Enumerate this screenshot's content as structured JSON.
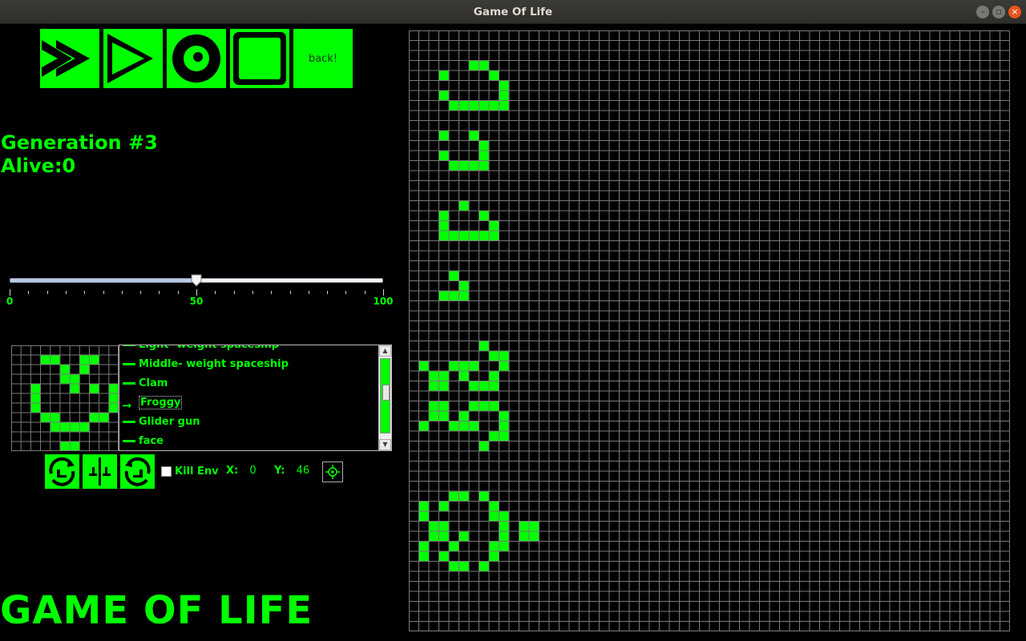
{
  "window": {
    "title": "Game Of Life"
  },
  "toolbar": {
    "buttons": [
      {
        "name": "fast-forward-button",
        "icon": "fast-forward-icon"
      },
      {
        "name": "play-button",
        "icon": "play-icon"
      },
      {
        "name": "reset-button",
        "icon": "reset-icon"
      },
      {
        "name": "stop-button",
        "icon": "stop-icon"
      }
    ],
    "back_label": "back!"
  },
  "stats": {
    "generation": "Generation #3",
    "alive": "Alive:0"
  },
  "speed_slider": {
    "min": 0,
    "max": 100,
    "value": 50,
    "labels": [
      "0",
      "50",
      "100"
    ]
  },
  "patterns": {
    "items": [
      "Light- weight spaceship",
      "Middle- weight spaceship",
      "Clam",
      "Froggy",
      "Glider gun",
      "face"
    ],
    "selected": "Froggy"
  },
  "preview_cells": [
    [
      3,
      1
    ],
    [
      4,
      1
    ],
    [
      7,
      1
    ],
    [
      8,
      1
    ],
    [
      5,
      2
    ],
    [
      7,
      2
    ],
    [
      5,
      3
    ],
    [
      6,
      3
    ],
    [
      2,
      4
    ],
    [
      6,
      4
    ],
    [
      8,
      4
    ],
    [
      10,
      4
    ],
    [
      2,
      5
    ],
    [
      10,
      5
    ],
    [
      2,
      6
    ],
    [
      10,
      6
    ],
    [
      3,
      7
    ],
    [
      4,
      7
    ],
    [
      8,
      7
    ],
    [
      9,
      7
    ],
    [
      4,
      8
    ],
    [
      5,
      8
    ],
    [
      6,
      8
    ],
    [
      7,
      8
    ],
    [
      5,
      10
    ],
    [
      6,
      10
    ],
    [
      5,
      11
    ],
    [
      6,
      11
    ]
  ],
  "controls": {
    "kill_env_label": "Kill Env",
    "kill_env_checked": false,
    "x_label": "X:",
    "x_value": "0",
    "y_label": "Y:",
    "y_value": "46"
  },
  "board_cells": [
    [
      6,
      3
    ],
    [
      7,
      3
    ],
    [
      3,
      4
    ],
    [
      8,
      4
    ],
    [
      9,
      5
    ],
    [
      3,
      6
    ],
    [
      9,
      6
    ],
    [
      4,
      7
    ],
    [
      5,
      7
    ],
    [
      6,
      7
    ],
    [
      7,
      7
    ],
    [
      8,
      7
    ],
    [
      9,
      7
    ],
    [
      3,
      10
    ],
    [
      6,
      10
    ],
    [
      7,
      11
    ],
    [
      3,
      12
    ],
    [
      7,
      12
    ],
    [
      4,
      13
    ],
    [
      5,
      13
    ],
    [
      6,
      13
    ],
    [
      7,
      13
    ],
    [
      5,
      17
    ],
    [
      3,
      18
    ],
    [
      7,
      18
    ],
    [
      3,
      19
    ],
    [
      8,
      19
    ],
    [
      3,
      20
    ],
    [
      4,
      20
    ],
    [
      5,
      20
    ],
    [
      6,
      20
    ],
    [
      7,
      20
    ],
    [
      8,
      20
    ],
    [
      4,
      24
    ],
    [
      5,
      25
    ],
    [
      3,
      26
    ],
    [
      4,
      26
    ],
    [
      5,
      26
    ],
    [
      7,
      31
    ],
    [
      8,
      32
    ],
    [
      9,
      32
    ],
    [
      1,
      33
    ],
    [
      4,
      33
    ],
    [
      5,
      33
    ],
    [
      6,
      33
    ],
    [
      9,
      33
    ],
    [
      2,
      34
    ],
    [
      3,
      34
    ],
    [
      5,
      34
    ],
    [
      8,
      34
    ],
    [
      2,
      35
    ],
    [
      3,
      35
    ],
    [
      6,
      35
    ],
    [
      7,
      35
    ],
    [
      8,
      35
    ],
    [
      2,
      37
    ],
    [
      3,
      37
    ],
    [
      6,
      37
    ],
    [
      7,
      37
    ],
    [
      8,
      37
    ],
    [
      2,
      38
    ],
    [
      3,
      38
    ],
    [
      5,
      38
    ],
    [
      9,
      38
    ],
    [
      1,
      39
    ],
    [
      4,
      39
    ],
    [
      5,
      39
    ],
    [
      6,
      39
    ],
    [
      9,
      39
    ],
    [
      8,
      40
    ],
    [
      9,
      40
    ],
    [
      7,
      41
    ],
    [
      4,
      46
    ],
    [
      5,
      46
    ],
    [
      7,
      46
    ],
    [
      1,
      47
    ],
    [
      3,
      47
    ],
    [
      8,
      47
    ],
    [
      1,
      48
    ],
    [
      8,
      48
    ],
    [
      9,
      48
    ],
    [
      2,
      49
    ],
    [
      3,
      49
    ],
    [
      9,
      49
    ],
    [
      11,
      49
    ],
    [
      12,
      49
    ],
    [
      2,
      50
    ],
    [
      3,
      50
    ],
    [
      5,
      50
    ],
    [
      9,
      50
    ],
    [
      11,
      50
    ],
    [
      12,
      50
    ],
    [
      1,
      51
    ],
    [
      4,
      51
    ],
    [
      8,
      51
    ],
    [
      9,
      51
    ],
    [
      1,
      52
    ],
    [
      3,
      52
    ],
    [
      8,
      52
    ],
    [
      4,
      53
    ],
    [
      5,
      53
    ],
    [
      7,
      53
    ]
  ],
  "big_title": "GAME OF LIFE",
  "colors": {
    "accent": "#00ff00",
    "background": "#000000",
    "grid": "#7a7a7a"
  }
}
